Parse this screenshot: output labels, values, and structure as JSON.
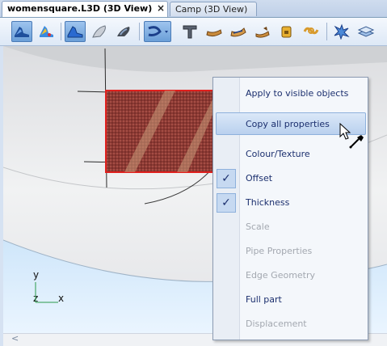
{
  "tabs": [
    {
      "label": "womensquare.L3D (3D View)",
      "active": true,
      "close": "×"
    },
    {
      "label": "Camp (3D View)",
      "active": false
    }
  ],
  "toolbar": {
    "buttons": [
      "shoe-view-icon",
      "shoe-color-icon",
      "shoe-outline-icon",
      "insole-icon",
      "last-icon",
      "curve-tool-icon",
      "text-tool-icon",
      "sole-icon",
      "sole-alt-icon",
      "heel-icon",
      "lock-icon",
      "loop-icon",
      "burst-icon",
      "stack-icon"
    ]
  },
  "viewport": {
    "axis": {
      "y": "y",
      "z": "z",
      "x": "x"
    },
    "selected_part_color": "#e0201e"
  },
  "context_menu": {
    "items": [
      {
        "label": "Apply to visible objects",
        "enabled": true,
        "checked": false
      },
      {
        "label": "Copy all properties",
        "enabled": true,
        "checked": false,
        "highlighted": true
      },
      {
        "label": "Colour/Texture",
        "enabled": true,
        "checked": false
      },
      {
        "label": "Offset",
        "enabled": true,
        "checked": true
      },
      {
        "label": "Thickness",
        "enabled": true,
        "checked": true
      },
      {
        "label": "Scale",
        "enabled": false,
        "checked": false
      },
      {
        "label": "Pipe Properties",
        "enabled": false,
        "checked": false
      },
      {
        "label": "Edge Geometry",
        "enabled": false,
        "checked": false
      },
      {
        "label": "Full part",
        "enabled": true,
        "checked": false
      },
      {
        "label": "Displacement",
        "enabled": false,
        "checked": false
      }
    ],
    "check_glyph": "✓"
  },
  "scrollbar": {
    "left_arrow": "<"
  }
}
